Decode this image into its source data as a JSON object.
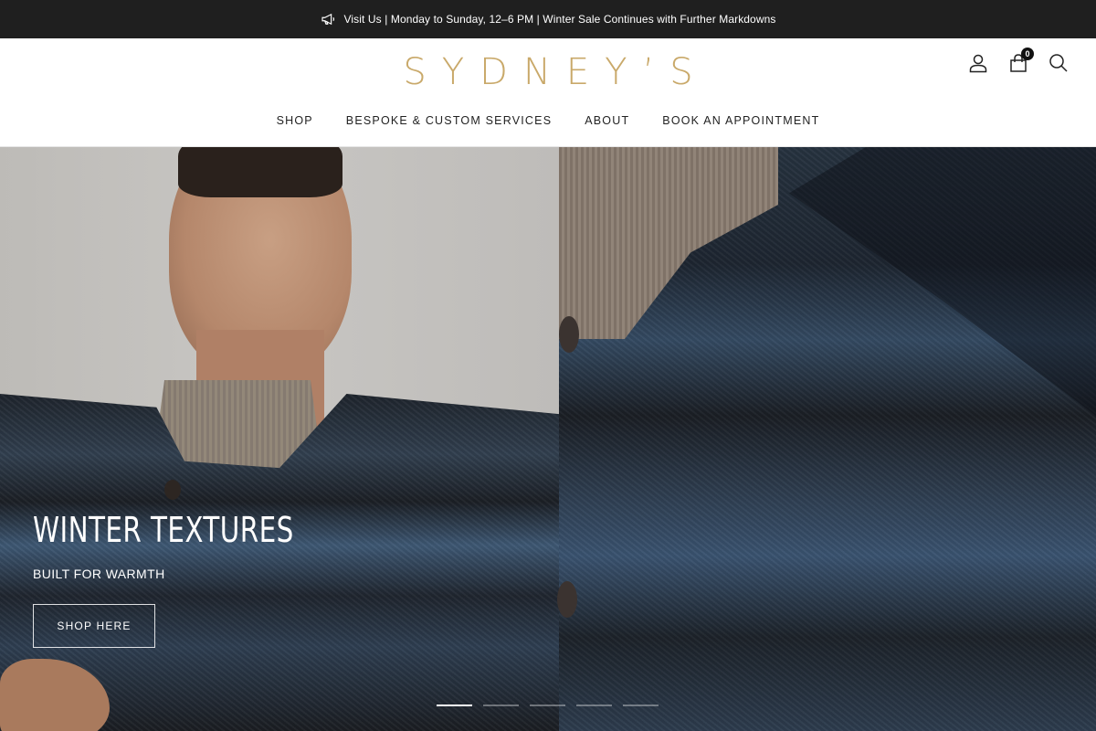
{
  "announcement": {
    "text": "Visit Us | Monday to Sunday, 12–6 PM | Winter Sale Continues with Further Markdowns",
    "icon": "megaphone-icon"
  },
  "header": {
    "logo_text": "SYDNEY’S",
    "cart_count": "0",
    "icons": [
      "account-icon",
      "cart-icon",
      "search-icon"
    ],
    "brand_color": "#c9a96a"
  },
  "nav": {
    "items": [
      {
        "label": "SHOP"
      },
      {
        "label": "BESPOKE & CUSTOM SERVICES"
      },
      {
        "label": "ABOUT"
      },
      {
        "label": "BOOK AN APPOINTMENT"
      }
    ]
  },
  "hero": {
    "title": "WINTER TEXTURES",
    "subtitle": "BUILT FOR WARMTH",
    "cta_label": "SHOP HERE",
    "slide_count": 5,
    "active_slide": 1
  }
}
